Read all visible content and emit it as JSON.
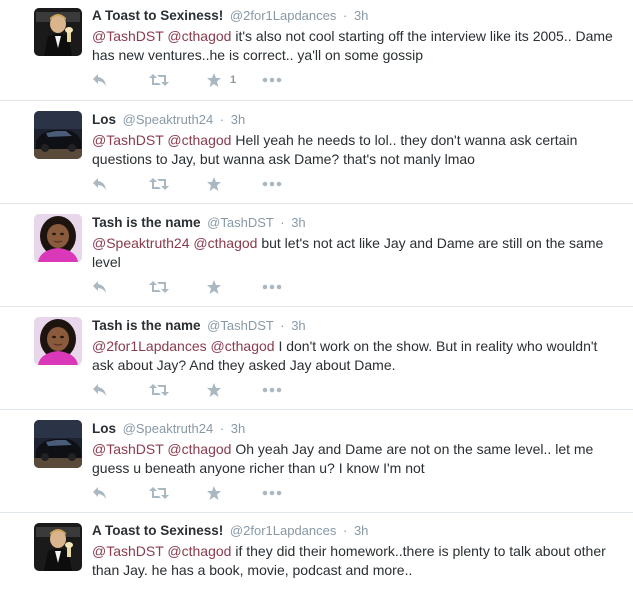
{
  "tweets": [
    {
      "name": "A Toast to Sexiness!",
      "handle": "@2for1Lapdances",
      "time": "3h",
      "mention1": "@TashDST",
      "mention2": "@cthagod",
      "text": " it's also not cool starting off the interview like its 2005.. Dame has new ventures..he is correct.. ya'll on some gossip",
      "favorites": "1",
      "avatar": "man-in-tuxedo"
    },
    {
      "name": "Los",
      "handle": "@Speaktruth24",
      "time": "3h",
      "mention1": "@TashDST",
      "mention2": "@cthagod",
      "text": " Hell yeah he needs to lol.. they don't wanna ask certain questions to Jay, but wanna ask Dame? that's not manly lmao",
      "favorites": "",
      "avatar": "dark-car"
    },
    {
      "name": "Tash is the name",
      "handle": "@TashDST",
      "time": "3h",
      "mention1": "@Speaktruth24",
      "mention2": "@cthagod",
      "text": " but let's not act like Jay and Dame are still on the same level",
      "favorites": "",
      "avatar": "woman-pink"
    },
    {
      "name": "Tash is the name",
      "handle": "@TashDST",
      "time": "3h",
      "mention1": "@2for1Lapdances",
      "mention2": "@cthagod",
      "text": " I don't work on the show. But in reality who wouldn't ask about Jay? And they asked Jay about Dame.",
      "favorites": "",
      "avatar": "woman-pink"
    },
    {
      "name": "Los",
      "handle": "@Speaktruth24",
      "time": "3h",
      "mention1": "@TashDST",
      "mention2": "@cthagod",
      "text": " Oh yeah Jay and Dame are not on the same level.. let me guess u beneath anyone richer than u? I know I'm not",
      "favorites": "",
      "avatar": "dark-car"
    },
    {
      "name": "A Toast to Sexiness!",
      "handle": "@2for1Lapdances",
      "time": "3h",
      "mention1": "@TashDST",
      "mention2": "@cthagod",
      "text": " if they did their homework..there is plenty to talk about other than Jay. he has a book, movie, podcast and more..",
      "favorites": "",
      "avatar": "man-in-tuxedo"
    }
  ],
  "separator": "·",
  "icons": {
    "reply": "reply-icon",
    "retweet": "retweet-icon",
    "favorite": "star-icon",
    "more": "more-icon"
  },
  "colors": {
    "mention": "#8a3b4c",
    "meta": "#8899a6",
    "icon": "#aab8c2",
    "divider": "#e1e8ed"
  }
}
